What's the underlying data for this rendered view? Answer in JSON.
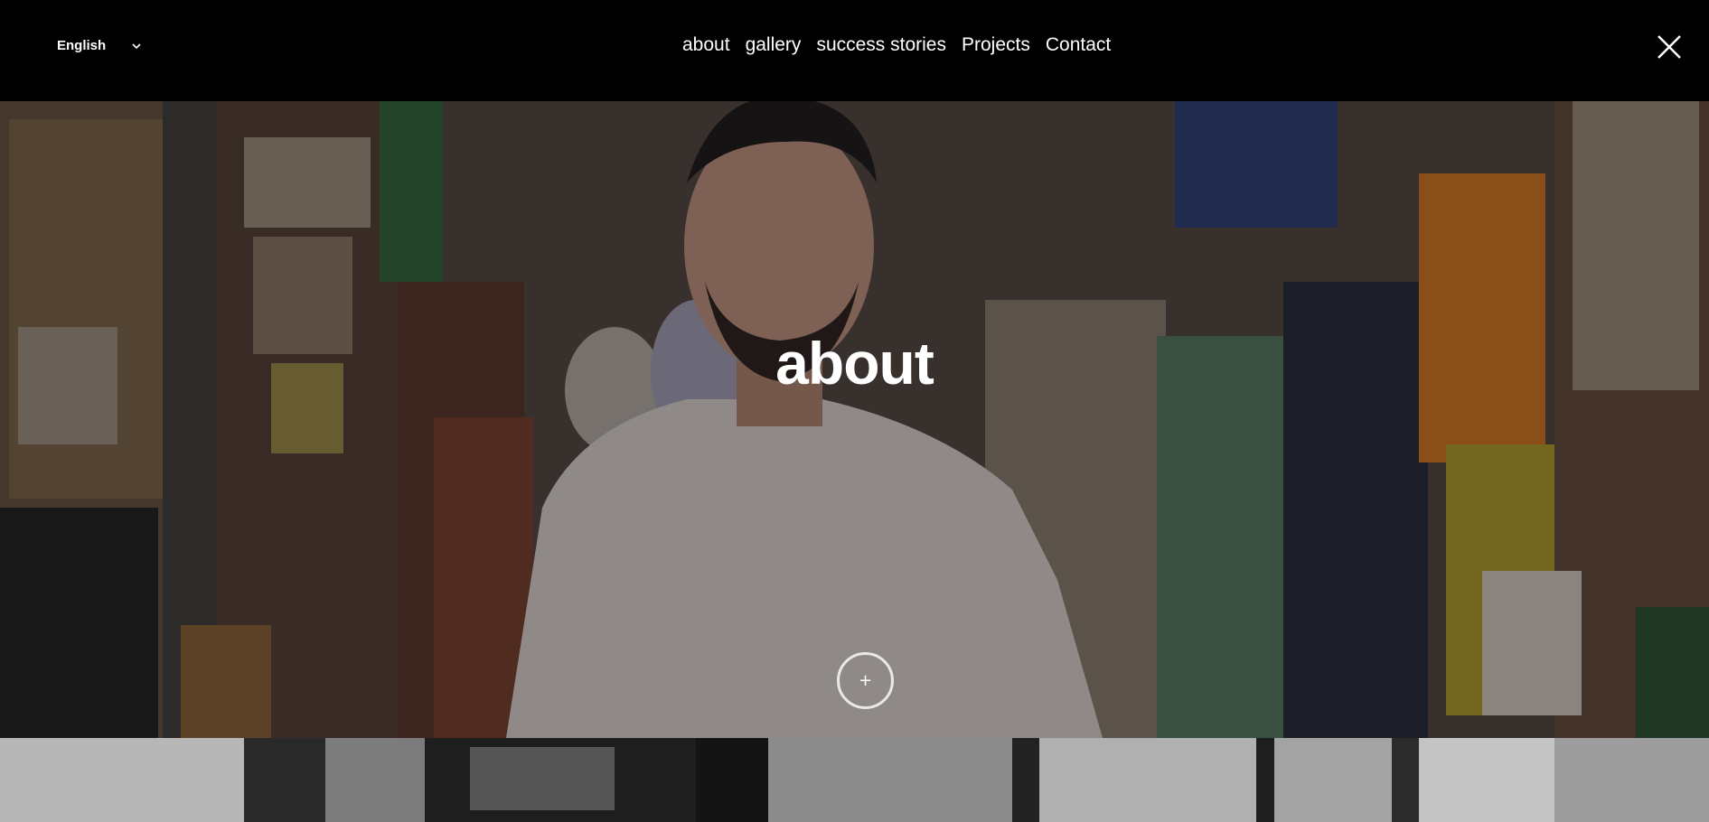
{
  "header": {
    "language": {
      "label": "English",
      "icon": "chevron-down-icon"
    },
    "nav": [
      {
        "label": "about"
      },
      {
        "label": "gallery"
      },
      {
        "label": "success stories"
      },
      {
        "label": "Projects"
      },
      {
        "label": "Contact"
      }
    ],
    "close_icon": "close-icon"
  },
  "hero": {
    "title": "about",
    "expand_button": {
      "label": "+",
      "icon": "plus-icon"
    }
  }
}
